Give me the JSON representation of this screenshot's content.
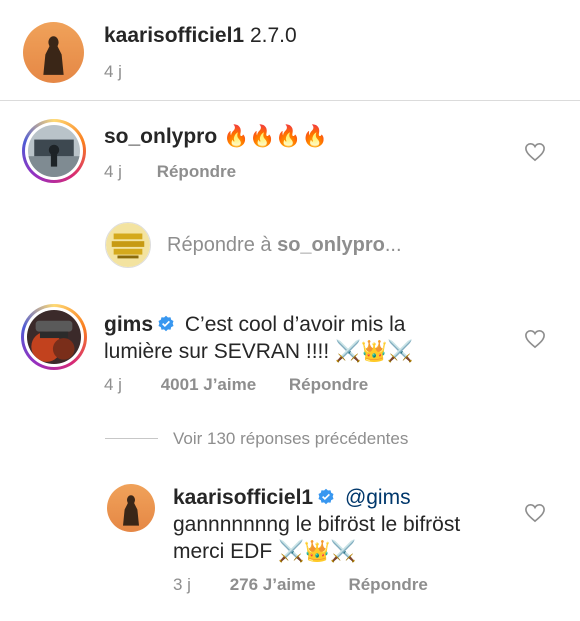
{
  "comments": [
    {
      "username": "kaarisofficiel1",
      "text": "2.7.0",
      "time": "4 j"
    },
    {
      "username": "so_onlypro",
      "emojis": "🔥🔥🔥🔥",
      "time": "4 j",
      "reply_label": "Répondre"
    },
    {
      "username": "gims",
      "text_line1": "C’est cool d’avoir mis la",
      "text_line2": "lumière sur SEVRAN !!!! ",
      "emojis": "⚔️👑⚔️",
      "time": "4 j",
      "likes": "4001 J’aime",
      "reply_label": "Répondre"
    }
  ],
  "reply_box": {
    "prefix": "Répondre à ",
    "target": "so_onlypro",
    "ellipsis": "..."
  },
  "view_more": "Voir 130 réponses précédentes",
  "reply": {
    "username": "kaarisofficiel1",
    "mention": "@gims",
    "text_line2": "gannnnnnng le bifröst le bifröst",
    "text_line3": "merci EDF ",
    "emojis": "⚔️👑⚔️",
    "time": "3 j",
    "likes": "276 J’aime",
    "reply_label": "Répondre"
  },
  "colors": {
    "text": "#262626",
    "secondary": "#8e8e8e",
    "verified": "#3897f0",
    "mention": "#00376b"
  }
}
